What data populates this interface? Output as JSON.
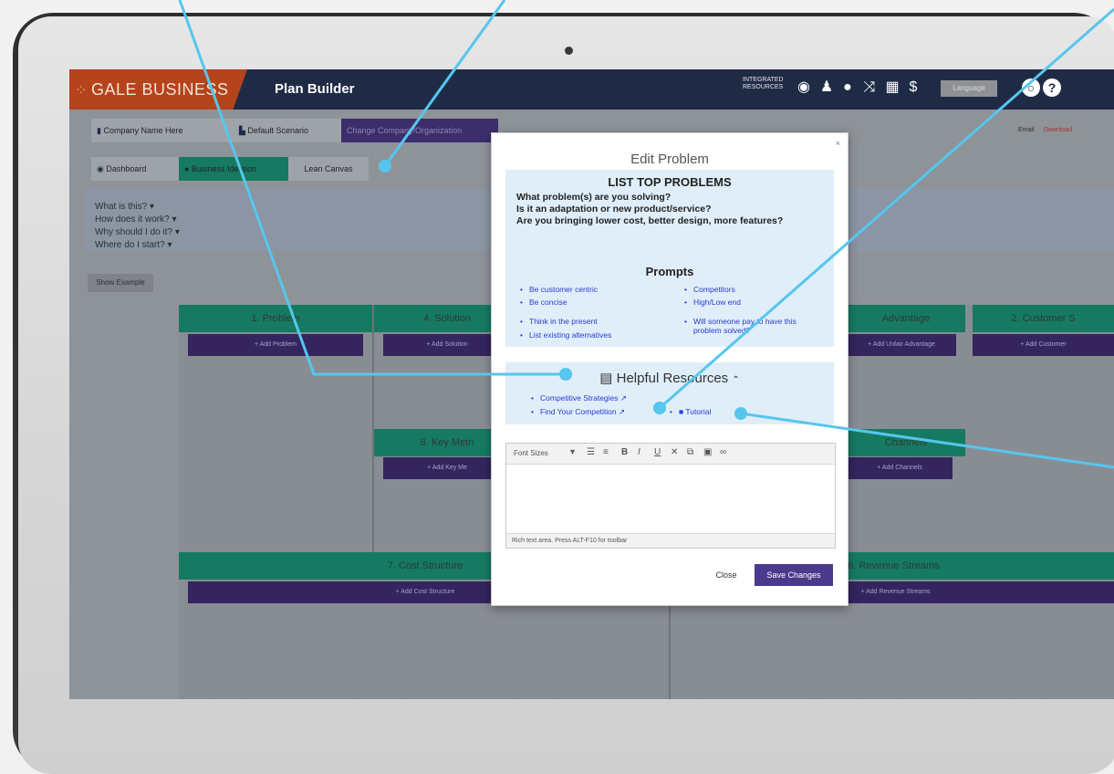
{
  "app": {
    "brand": "GALE BUSINESS",
    "title": "Plan Builder",
    "integrated_resources": "INTEGRATED RESOURCES",
    "language_label": "Language"
  },
  "context_bar": {
    "company": "Company Name Here",
    "scenario": "Default Scenario",
    "change_org": "Change Company/Organization",
    "email": "Email",
    "download": "Download"
  },
  "view_tabs": [
    "Dashboard",
    "Business Ideation",
    "Lean Canvas"
  ],
  "help_links": [
    "What is this? ▾",
    "How does it work? ▾",
    "Why should I do it? ▾",
    "Where do I start? ▾"
  ],
  "show_example": "Show Example",
  "canvas": {
    "problem": {
      "title": "1. Problem",
      "add": "+ Add Problem"
    },
    "solution": {
      "title": "4. Solution",
      "add": "+ Add Solution"
    },
    "advantage": {
      "title": "Advantage",
      "add": "+ Add Unfair Advantage"
    },
    "customer": {
      "title": "2. Customer S",
      "add": "+ Add Customer"
    },
    "key_metrics": {
      "title": "8. Key Metri",
      "add": "+ Add Key Me"
    },
    "channels": {
      "title": "Channels",
      "add": "+ Add Channels"
    },
    "cost": {
      "title": "7. Cost Structure",
      "add": "+ Add Cost Structure"
    },
    "revenue": {
      "title": "6. Revenue Streams",
      "add": "+ Add Revenue Streams"
    }
  },
  "modal": {
    "title": "Edit Problem",
    "close_x": "×",
    "box_title": "LIST TOP PROBLEMS",
    "questions": [
      "What problem(s) are you solving?",
      "Is it an adaptation or new product/service?",
      "Are you bringing lower cost, better design, more features?"
    ],
    "prompts_title": "Prompts",
    "prompts_left": [
      "Be customer centric",
      "Be concise",
      "Think in the present",
      "List existing alternatives"
    ],
    "prompts_right": [
      "Competitors",
      "High/Low end",
      "Will someone pay to have this problem solved?"
    ],
    "resources_title": "Helpful Resources",
    "resources_toggle": "⌃",
    "resource_links": [
      "Competitive Strategies",
      "Find Your Competition"
    ],
    "tutorial": "Tutorial",
    "editor": {
      "font_sizes": "Font Sizes",
      "status": "Rich text area. Press ALT-F10 for toolbar"
    },
    "close_button": "Close",
    "save_button": "Save Changes"
  },
  "colors": {
    "accent_purple": "#4b3a8c",
    "teal": "#1aa583",
    "brand_orange": "#b5431b",
    "navy": "#1f2b45",
    "callout": "#56c6ee"
  }
}
